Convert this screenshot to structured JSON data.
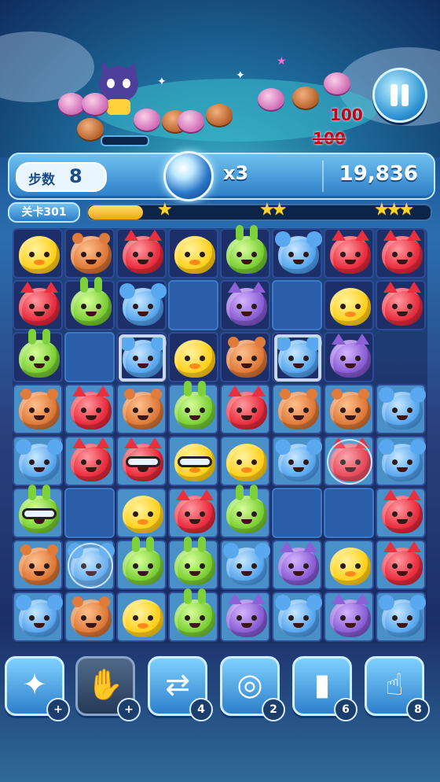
{
  "top": {
    "floating_scores": [
      "100",
      "100"
    ]
  },
  "info_bar": {
    "moves_label": "步数",
    "moves_value": "8",
    "multiplier": "x3",
    "score": "19,836"
  },
  "level": {
    "label": "关卡301",
    "progress": 0.16,
    "stars": [
      "★",
      "★★",
      "★★★"
    ]
  },
  "board": {
    "rows": [
      [
        "chick",
        "bear",
        "fox",
        "chick",
        "bunny",
        "mouse",
        "fox",
        "fox"
      ],
      [
        "fox",
        "bunny",
        "mouse",
        "empty",
        "cat",
        "empty",
        "chick",
        "fox"
      ],
      [
        "bunny",
        "empty",
        "mouse-caged",
        "chick",
        "bear",
        "mouse-caged",
        "cat",
        "void"
      ],
      [
        "bear",
        "fox",
        "bear",
        "bunny",
        "fox",
        "bear",
        "bear",
        "mouse"
      ],
      [
        "mouse",
        "fox",
        "fox-goggles",
        "chick-goggles",
        "chick",
        "mouse",
        "fox-bubble",
        "mouse"
      ],
      [
        "bunny-goggles",
        "empty",
        "chick",
        "fox",
        "bunny",
        "empty",
        "empty",
        "fox"
      ],
      [
        "bear",
        "mouse-bubble",
        "bunny",
        "bunny",
        "mouse",
        "cat",
        "chick",
        "fox"
      ],
      [
        "mouse",
        "bear",
        "chick",
        "bunny",
        "cat",
        "mouse",
        "cat",
        "mouse"
      ]
    ]
  },
  "boosters": [
    {
      "name": "magic-wand",
      "glyph": "✦",
      "badge": "+"
    },
    {
      "name": "glove-x3",
      "glyph": "✋",
      "badge": "+"
    },
    {
      "name": "swap-arrows",
      "glyph": "⇄",
      "badge": "4"
    },
    {
      "name": "goggles",
      "glyph": "◎",
      "badge": "2"
    },
    {
      "name": "paint-roller",
      "glyph": "▮",
      "badge": "6"
    },
    {
      "name": "pointing-hand",
      "glyph": "☝",
      "badge": "8"
    }
  ],
  "colors": {
    "accent": "#2c7cc5",
    "star": "#ffd52e",
    "score_float": "#c40012"
  }
}
